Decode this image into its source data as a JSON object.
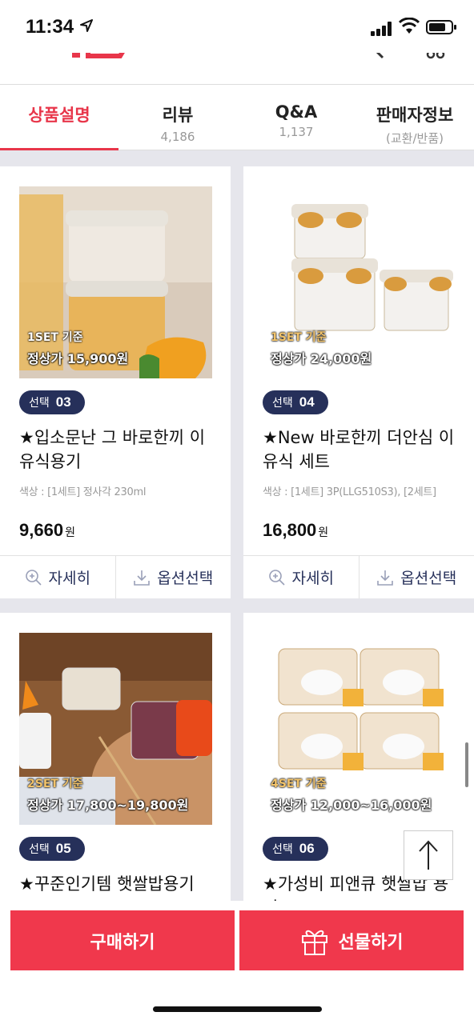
{
  "status": {
    "time": "11:34"
  },
  "tabs": [
    {
      "label": "상품설명",
      "sub": ""
    },
    {
      "label": "리뷰",
      "sub": "4,186"
    },
    {
      "label": "Q&A",
      "sub": "1,137"
    },
    {
      "label": "판매자정보",
      "sub": "(교환/반품)"
    }
  ],
  "products": [
    {
      "set": "1SET 기준",
      "list_price": "정상가 15,900원",
      "badge_label": "선택",
      "badge_num": "03",
      "title": "★입소문난 그 바로한끼 이유식용기",
      "option": "색상 : [1세트] 정사각 230ml",
      "price": "9,660",
      "unit": "원"
    },
    {
      "set": "1SET 기준",
      "list_price": "정상가 24,000원",
      "badge_label": "선택",
      "badge_num": "04",
      "title": "★New 바로한끼 더안심 이유식 세트",
      "option": "색상 : [1세트] 3P(LLG510S3), [2세트]",
      "price": "16,800",
      "unit": "원"
    },
    {
      "set": "2SET 기준",
      "list_price": "정상가 17,800~19,800원",
      "badge_label": "선택",
      "badge_num": "05",
      "title": "★꾸준인기템 햇쌀밥용기"
    },
    {
      "set": "4SET 기준",
      "list_price": "정상가 12,000~16,000원",
      "badge_label": "선택",
      "badge_num": "06",
      "title": "★가성비 피앤큐 햇쌀밥 용기"
    }
  ],
  "actions": {
    "detail": "자세히",
    "option": "옵션선택"
  },
  "bottom": {
    "buy": "구매하기",
    "gift": "선물하기"
  },
  "colors": {
    "accent": "#e8364a",
    "navy": "#26305a",
    "button": "#f0384c"
  }
}
